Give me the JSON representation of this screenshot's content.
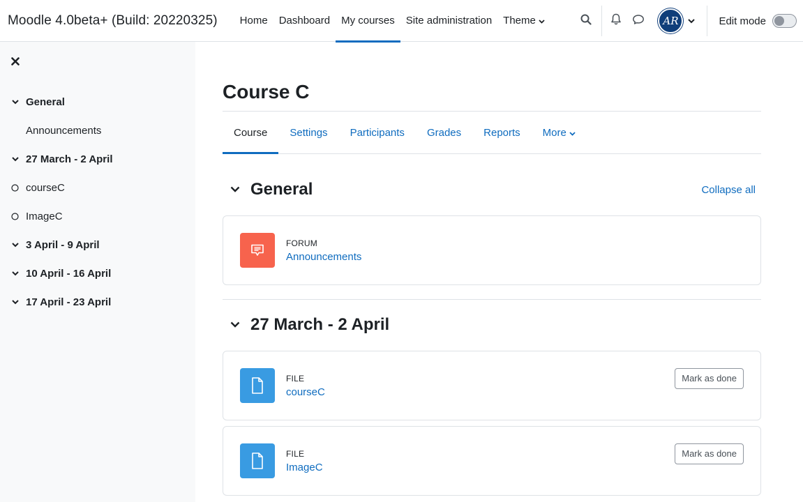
{
  "navbar": {
    "site_name": "Moodle 4.0beta+ (Build: 20220325)",
    "links": [
      {
        "label": "Home"
      },
      {
        "label": "Dashboard"
      },
      {
        "label": "My courses"
      },
      {
        "label": "Site administration"
      },
      {
        "label": "Theme"
      }
    ],
    "active_link": "My courses",
    "avatar_initials": "AR",
    "edit_mode_label": "Edit mode",
    "edit_mode_on": false
  },
  "drawer": {
    "items": [
      {
        "label": "General",
        "kind": "section"
      },
      {
        "label": "Announcements",
        "kind": "activity-plain"
      },
      {
        "label": "27 March - 2 April",
        "kind": "section"
      },
      {
        "label": "courseC",
        "kind": "activity-circle"
      },
      {
        "label": "ImageC",
        "kind": "activity-circle"
      },
      {
        "label": "3 April - 9 April",
        "kind": "section"
      },
      {
        "label": "10 April - 16 April",
        "kind": "section"
      },
      {
        "label": "17 April - 23 April",
        "kind": "section"
      }
    ]
  },
  "course": {
    "title": "Course C",
    "tabs": [
      {
        "label": "Course"
      },
      {
        "label": "Settings"
      },
      {
        "label": "Participants"
      },
      {
        "label": "Grades"
      },
      {
        "label": "Reports"
      },
      {
        "label": "More"
      }
    ],
    "active_tab": "Course",
    "collapse_all_label": "Collapse all",
    "sections": [
      {
        "title": "General",
        "activities": [
          {
            "type": "FORUM",
            "name": "Announcements",
            "icon": "forum-icon",
            "mark_done": ""
          }
        ]
      },
      {
        "title": "27 March - 2 April",
        "activities": [
          {
            "type": "FILE",
            "name": "courseC",
            "icon": "file-icon",
            "mark_done": "Mark as done"
          },
          {
            "type": "FILE",
            "name": "ImageC",
            "icon": "file-icon",
            "mark_done": "Mark as done"
          }
        ]
      }
    ]
  },
  "colors": {
    "link": "#0f6cbf",
    "forum": "#f7634d",
    "file": "#399be2",
    "drawer_bg": "#f8f9fa",
    "avatar_bg": "#0f3e7a"
  }
}
